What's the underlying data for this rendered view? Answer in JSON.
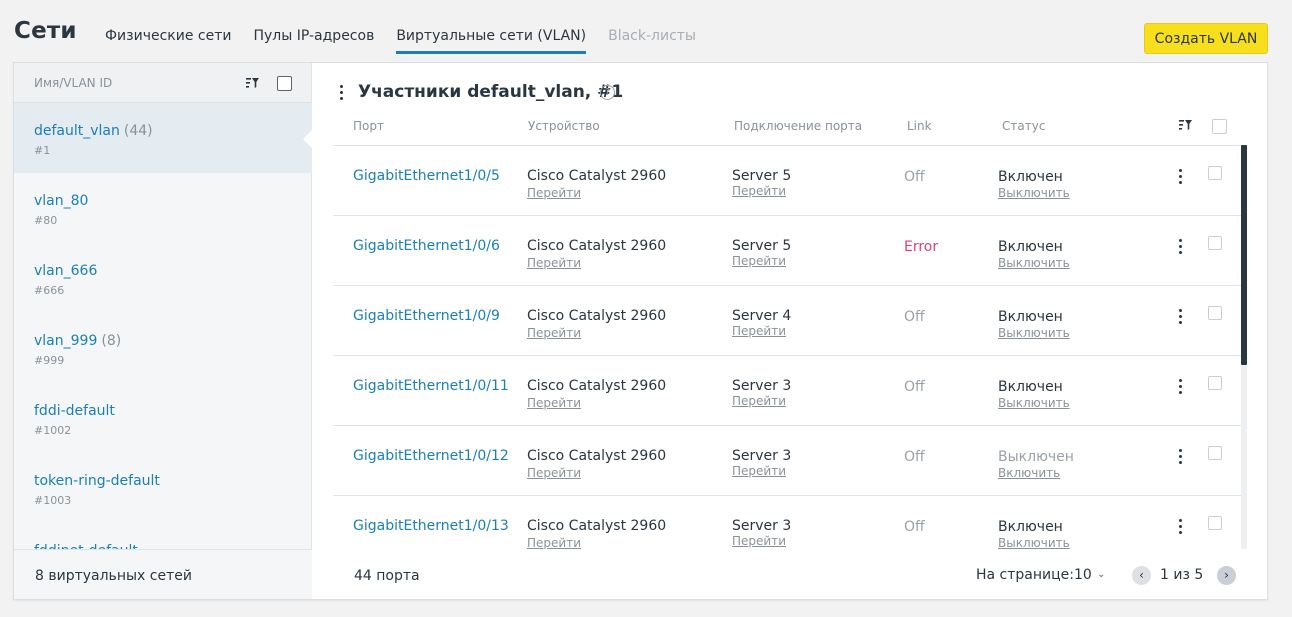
{
  "header": {
    "title": "Сети",
    "tabs": [
      {
        "label": "Физические сети",
        "state": "normal"
      },
      {
        "label": "Пулы IP-адресов",
        "state": "normal"
      },
      {
        "label": "Виртуальные сети (VLAN)",
        "state": "active"
      },
      {
        "label": "Black-листы",
        "state": "disabled"
      }
    ],
    "create_button": "Создать VLAN"
  },
  "sidebar": {
    "column_label": "Имя/VLAN ID",
    "items": [
      {
        "name": "default_vlan",
        "count": "(44)",
        "id": "#1"
      },
      {
        "name": "vlan_80",
        "count": "",
        "id": "#80"
      },
      {
        "name": "vlan_666",
        "count": "",
        "id": "#666"
      },
      {
        "name": "vlan_999",
        "count": "(8)",
        "id": "#999"
      },
      {
        "name": "fddi-default",
        "count": "",
        "id": "#1002"
      },
      {
        "name": "token-ring-default",
        "count": "",
        "id": "#1003"
      },
      {
        "name": "fddinet-default",
        "count": "",
        "id": ""
      }
    ],
    "footer": "8 виртуальных сетей"
  },
  "main": {
    "title": "Участники default_vlan, #1",
    "help_icon": "?",
    "columns": {
      "port": "Порт",
      "device": "Устройство",
      "connection": "Подключение порта",
      "link": "Link",
      "status": "Статус"
    },
    "rows": [
      {
        "port": "GigabitEthernet1/0/5",
        "device": "Cisco Catalyst 2960",
        "device_link": "Перейти",
        "connection": "Server 5",
        "connection_link": "Перейти",
        "link": "Off",
        "link_error": false,
        "status": "Включен",
        "status_on": true,
        "status_action": "Выключить"
      },
      {
        "port": "GigabitEthernet1/0/6",
        "device": "Cisco Catalyst 2960",
        "device_link": "Перейти",
        "connection": "Server 5",
        "connection_link": "Перейти",
        "link": "Error",
        "link_error": true,
        "status": "Включен",
        "status_on": true,
        "status_action": "Выключить"
      },
      {
        "port": "GigabitEthernet1/0/9",
        "device": "Cisco Catalyst 2960",
        "device_link": "Перейти",
        "connection": "Server 4",
        "connection_link": "Перейти",
        "link": "Off",
        "link_error": false,
        "status": "Включен",
        "status_on": true,
        "status_action": "Выключить"
      },
      {
        "port": "GigabitEthernet1/0/11",
        "device": "Cisco Catalyst 2960",
        "device_link": "Перейти",
        "connection": "Server 3",
        "connection_link": "Перейти",
        "link": "Off",
        "link_error": false,
        "status": "Включен",
        "status_on": true,
        "status_action": "Выключить"
      },
      {
        "port": "GigabitEthernet1/0/12",
        "device": "Cisco Catalyst 2960",
        "device_link": "Перейти",
        "connection": "Server 3",
        "connection_link": "Перейти",
        "link": "Off",
        "link_error": false,
        "status": "Выключен",
        "status_on": false,
        "status_action": "Включить"
      },
      {
        "port": "GigabitEthernet1/0/13",
        "device": "Cisco Catalyst 2960",
        "device_link": "Перейти",
        "connection": "Server 3",
        "connection_link": "Перейти",
        "link": "Off",
        "link_error": false,
        "status": "Включен",
        "status_on": true,
        "status_action": "Выключить"
      }
    ],
    "footer": {
      "count": "44 порта",
      "per_page_label": "На странице:",
      "per_page_value": "10",
      "page_info": "1 из 5"
    }
  },
  "colors": {
    "accent": "#1b7fb5",
    "button": "#f7df1e",
    "error": "#d9427e"
  }
}
